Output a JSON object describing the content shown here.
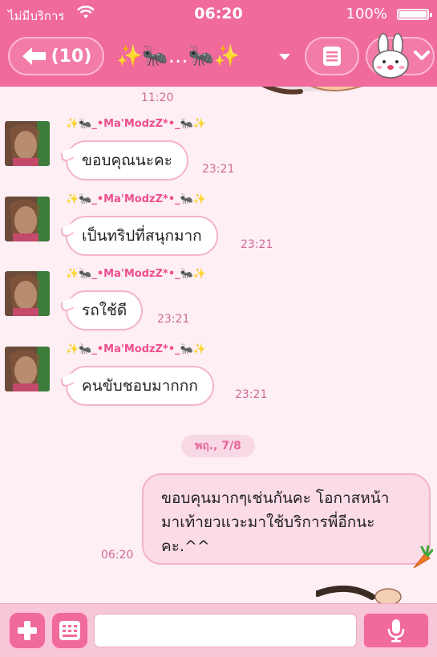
{
  "status_bar": {
    "carrier": "ไม่มีบริการ",
    "time": "06:20",
    "battery": "100%",
    "battery_level": 1.0
  },
  "nav": {
    "back_label": "(10)",
    "title": "✨🐜...🐜✨",
    "icons": {
      "back": "back-arrow-icon",
      "dropdown": "triangle-down-icon",
      "menu": "menu-list-icon",
      "sticker": "bunny-sticker-icon"
    }
  },
  "chat": {
    "top_time": "11:20",
    "messages": [
      {
        "sender": "✨🐜_•Ma'ModzZ*•_🐜✨",
        "text": "ขอบคุณนะคะ",
        "time": "23:21"
      },
      {
        "sender": "✨🐜_•Ma'ModzZ*•_🐜✨",
        "text": "เป็นทริปที่สนุกมาก",
        "time": "23:21"
      },
      {
        "sender": "✨🐜_•Ma'ModzZ*•_🐜✨",
        "text": "รถใช้ดี",
        "time": "23:21"
      },
      {
        "sender": "✨🐜_•Ma'ModzZ*•_🐜✨",
        "text": "คนขับชอบมากกก",
        "time": "23:21"
      }
    ],
    "date_separator": "พฤ., 7/8",
    "outgoing": {
      "line1": "ขอบคุนมากๆเช่นกันคะ โอกาสหน้า",
      "line2": "มาเท้ายวแวะมาใช้บริการพี่อีกนะ",
      "line3": "คะ.^^",
      "time": "06:20"
    }
  },
  "input_bar": {
    "placeholder": "",
    "icons": {
      "plus": "plus-icon",
      "keyboard": "keyboard-grid-icon",
      "mic": "microphone-icon"
    }
  },
  "colors": {
    "accent": "#f06a9c",
    "background": "#fdeff4",
    "bubble_border": "#f4b3cb",
    "outgoing_bubble": "#fcdbe8"
  }
}
